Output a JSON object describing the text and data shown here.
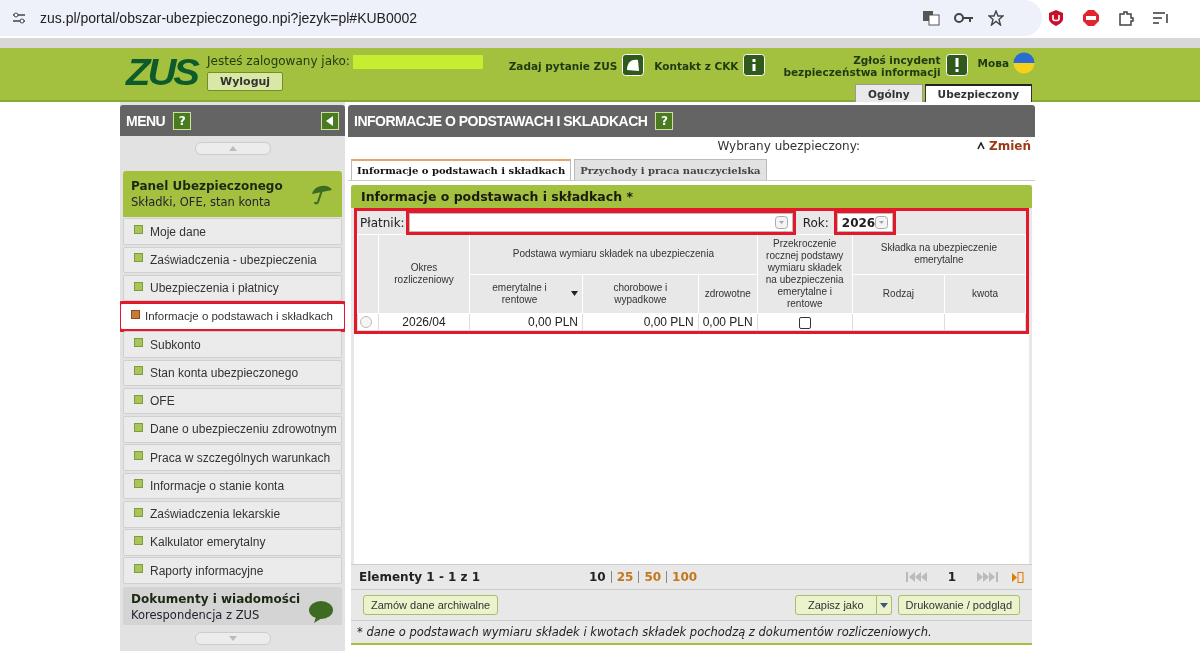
{
  "browser": {
    "url": "zus.pl/portal/obszar-ubezpieczonego.npi?jezyk=pl#KUB0002"
  },
  "header": {
    "logo": "ZUS",
    "logged_as_label": "Jesteś zalogowany jako:",
    "logout": "Wyloguj",
    "ask": "Zadaj pytanie ZUS",
    "contact": "Kontakt z CKK",
    "incident": [
      "Zgłoś incydent",
      "bezpieczeństwa informacji"
    ],
    "language": "Мова",
    "tabs": [
      {
        "label": "Ogólny",
        "selected": false
      },
      {
        "label": "Ubezpieczony",
        "selected": true
      }
    ]
  },
  "sidebar": {
    "title": "MENU",
    "help": "?",
    "panel": {
      "title": "Panel Ubezpieczonego",
      "subtitle": "Składki, OFE, stan konta"
    },
    "items": [
      {
        "label": "Moje dane",
        "selected": false,
        "highlighted": false
      },
      {
        "label": "Zaświadczenia - ubezpieczenia",
        "selected": false,
        "highlighted": false
      },
      {
        "label": "Ubezpieczenia i płatnicy",
        "selected": false,
        "highlighted": false
      },
      {
        "label": "Informacje o podstawach i składkach",
        "selected": true,
        "highlighted": true
      },
      {
        "label": "Subkonto",
        "selected": false,
        "highlighted": false
      },
      {
        "label": "Stan konta ubezpieczonego",
        "selected": false,
        "highlighted": false
      },
      {
        "label": "OFE",
        "selected": false,
        "highlighted": false
      },
      {
        "label": "Dane o ubezpieczeniu zdrowotnym",
        "selected": false,
        "highlighted": false
      },
      {
        "label": "Praca w szczególnych warunkach",
        "selected": false,
        "highlighted": false
      },
      {
        "label": "Informacje o stanie konta",
        "selected": false,
        "highlighted": false
      },
      {
        "label": "Zaświadczenia lekarskie",
        "selected": false,
        "highlighted": false
      },
      {
        "label": "Kalkulator emerytalny",
        "selected": false,
        "highlighted": false
      },
      {
        "label": "Raporty informacyjne",
        "selected": false,
        "highlighted": false
      }
    ],
    "panel2": {
      "title": "Dokumenty i wiadomości",
      "subtitle": "Korespondencja z ZUS"
    }
  },
  "main": {
    "title": "INFORMACJE O PODSTAWACH I SKLADKACH",
    "help": "?",
    "selected_label": "Wybrany ubezpieczony:",
    "change": "Zmień",
    "tabs": [
      {
        "label": "Informacje o podstawach i składkach",
        "selected": true
      },
      {
        "label": "Przychody i praca nauczycielska",
        "selected": false
      }
    ],
    "section_title": "Informacje o podstawach i składkach *",
    "filter": {
      "highlighted": true,
      "payer": {
        "label": "Płatnik:",
        "highlighted": true
      },
      "year": {
        "label": "Rok:",
        "value": "2026",
        "highlighted": true
      }
    },
    "table": {
      "group_1": "Podstawa wymiaru składek na ubezpieczenia",
      "group_2": "Składka na ubezpieczenie emerytalne",
      "columns": [
        "Okres rozliczeniowy",
        "emerytalne i rentowe",
        "chorobowe i wypadkowe",
        "zdrowotne",
        "Przekroczenie rocznej podstawy wymiaru składek na ubezpieczenia emerytalne i rentowe",
        "Rodzaj",
        "kwota"
      ],
      "rows": [
        {
          "selected": false,
          "period": "2026/04",
          "pension": "0,00 PLN",
          "sickness": "0,00 PLN",
          "health": "0,00 PLN",
          "exceeded": false
        }
      ]
    },
    "pager": {
      "summary": "Elementy 1 - 1 z 1",
      "sizes": [
        {
          "label": "10",
          "selected": true
        },
        {
          "label": "25",
          "selected": false
        },
        {
          "label": "50",
          "selected": false
        },
        {
          "label": "100",
          "selected": false
        }
      ],
      "page": "1"
    },
    "buttons": {
      "archive": "Zamów dane archiwalne",
      "save": "Zapisz jako",
      "print": "Drukowanie / podgląd"
    },
    "footnote": "* dane o podstawach wymiaru składek i kwotach składek pochodzą z dokumentów rozliczeniowych."
  }
}
